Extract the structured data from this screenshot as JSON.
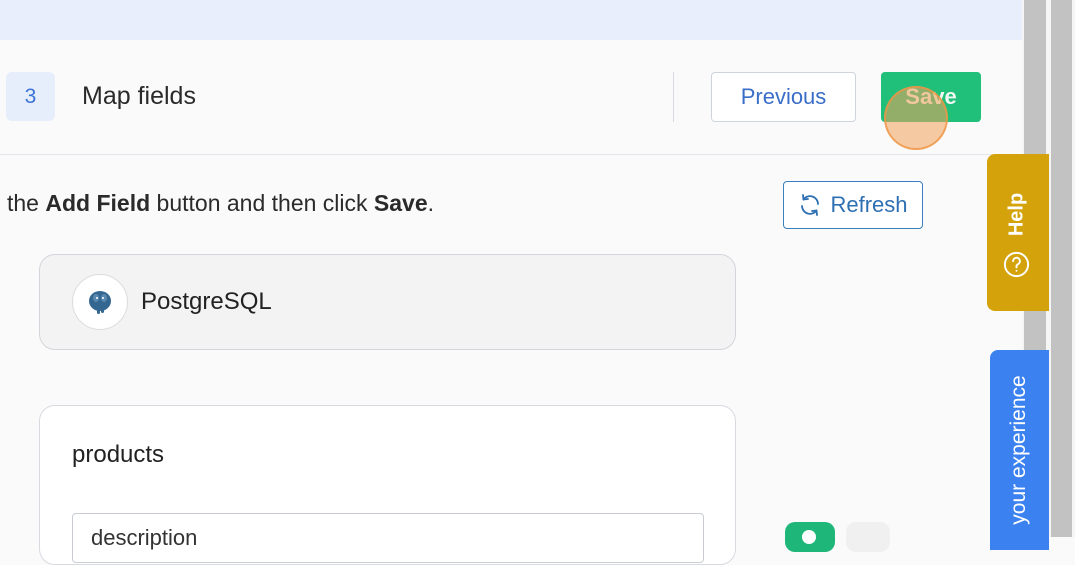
{
  "header": {
    "step_number": "3",
    "step_title": "Map fields",
    "previous_label": "Previous",
    "save_label": "Save"
  },
  "instruction": {
    "prefix": "the ",
    "bold1": "Add Field",
    "middle": " button and then click ",
    "bold2": "Save",
    "suffix": "."
  },
  "refresh_label": "Refresh",
  "app": {
    "name": "PostgreSQL",
    "logo_icon": "postgresql-elephant-icon"
  },
  "table": {
    "name": "products",
    "field_value": "description"
  },
  "side_tabs": {
    "help_label": "Help",
    "help_icon": "question-circle-icon",
    "experience_label": "your experience"
  },
  "colors": {
    "accent_blue": "#3a6ec8",
    "save_green": "#20bf7a",
    "help_gold": "#d4a30c",
    "feedback_blue": "#3b82f0"
  }
}
